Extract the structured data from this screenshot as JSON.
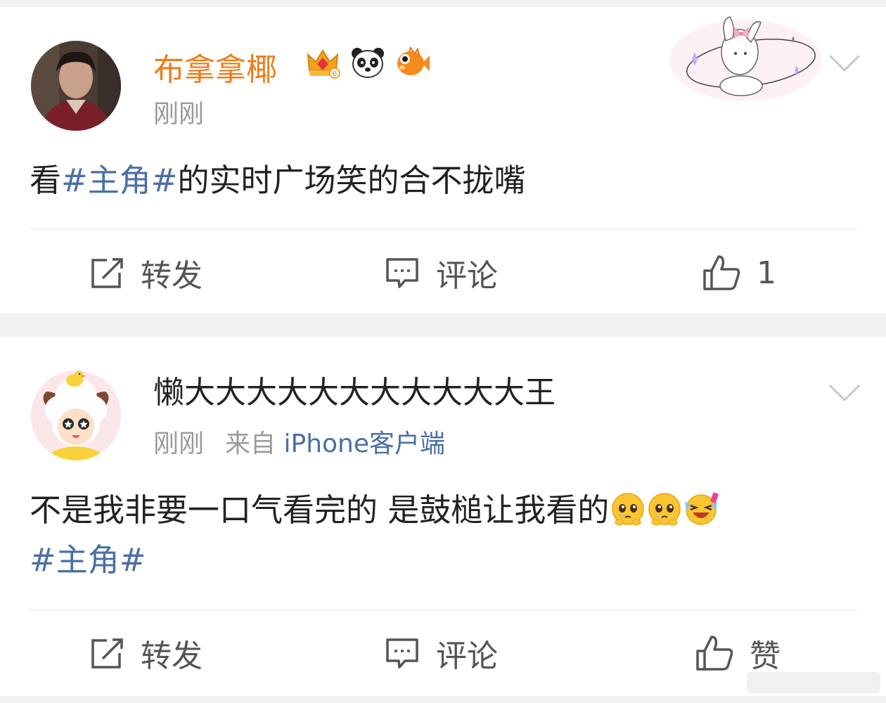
{
  "colors": {
    "page_bg": "#f1f1f1",
    "card_bg": "#ffffff",
    "username_vip": "#f07c1a",
    "username_normal": "#222222",
    "topic_link": "#4a6fa5",
    "meta_text": "#9a9a9a",
    "action_text": "#555555"
  },
  "posts": [
    {
      "username": "布拿拿椰",
      "username_style": "vip-orange",
      "badges": [
        "crown-level-6-icon",
        "panda-icon",
        "pufferfish-icon"
      ],
      "decoration": "bunny-bow-card-decoration",
      "time": "刚刚",
      "text_before": "看",
      "topic": "#主角#",
      "text_after": "的实时广场笑的合不拢嘴",
      "actions": {
        "repost": "转发",
        "comment": "评论",
        "like": "1"
      }
    },
    {
      "username": "懒大大大大大大大大大大大王",
      "username_style": "normal",
      "time": "刚刚",
      "source_prefix": "来自",
      "source_client": "iPhone客户端",
      "text_main": "不是我非要一口气看完的 是鼓槌让我看的",
      "emojis": [
        "pleading-face-icon",
        "pleading-face-icon",
        "laughing-tears-icon"
      ],
      "topic": "#主角#",
      "actions": {
        "repost": "转发",
        "comment": "评论",
        "like": "赞"
      }
    }
  ]
}
